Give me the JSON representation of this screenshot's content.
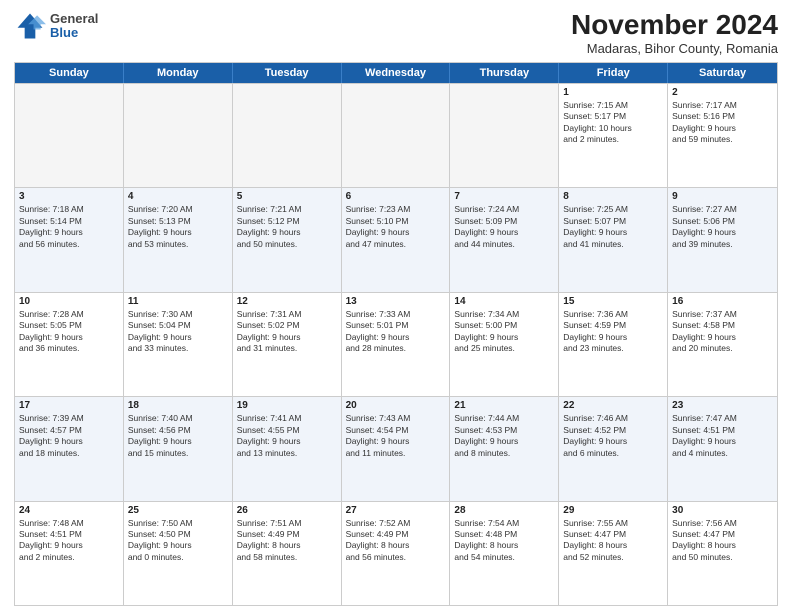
{
  "logo": {
    "general": "General",
    "blue": "Blue"
  },
  "title": "November 2024",
  "location": "Madaras, Bihor County, Romania",
  "days": [
    "Sunday",
    "Monday",
    "Tuesday",
    "Wednesday",
    "Thursday",
    "Friday",
    "Saturday"
  ],
  "rows": [
    [
      {
        "day": "",
        "text": "",
        "empty": true
      },
      {
        "day": "",
        "text": "",
        "empty": true
      },
      {
        "day": "",
        "text": "",
        "empty": true
      },
      {
        "day": "",
        "text": "",
        "empty": true
      },
      {
        "day": "",
        "text": "",
        "empty": true
      },
      {
        "day": "1",
        "text": "Sunrise: 7:15 AM\nSunset: 5:17 PM\nDaylight: 10 hours\nand 2 minutes."
      },
      {
        "day": "2",
        "text": "Sunrise: 7:17 AM\nSunset: 5:16 PM\nDaylight: 9 hours\nand 59 minutes."
      }
    ],
    [
      {
        "day": "3",
        "text": "Sunrise: 7:18 AM\nSunset: 5:14 PM\nDaylight: 9 hours\nand 56 minutes."
      },
      {
        "day": "4",
        "text": "Sunrise: 7:20 AM\nSunset: 5:13 PM\nDaylight: 9 hours\nand 53 minutes."
      },
      {
        "day": "5",
        "text": "Sunrise: 7:21 AM\nSunset: 5:12 PM\nDaylight: 9 hours\nand 50 minutes."
      },
      {
        "day": "6",
        "text": "Sunrise: 7:23 AM\nSunset: 5:10 PM\nDaylight: 9 hours\nand 47 minutes."
      },
      {
        "day": "7",
        "text": "Sunrise: 7:24 AM\nSunset: 5:09 PM\nDaylight: 9 hours\nand 44 minutes."
      },
      {
        "day": "8",
        "text": "Sunrise: 7:25 AM\nSunset: 5:07 PM\nDaylight: 9 hours\nand 41 minutes."
      },
      {
        "day": "9",
        "text": "Sunrise: 7:27 AM\nSunset: 5:06 PM\nDaylight: 9 hours\nand 39 minutes."
      }
    ],
    [
      {
        "day": "10",
        "text": "Sunrise: 7:28 AM\nSunset: 5:05 PM\nDaylight: 9 hours\nand 36 minutes."
      },
      {
        "day": "11",
        "text": "Sunrise: 7:30 AM\nSunset: 5:04 PM\nDaylight: 9 hours\nand 33 minutes."
      },
      {
        "day": "12",
        "text": "Sunrise: 7:31 AM\nSunset: 5:02 PM\nDaylight: 9 hours\nand 31 minutes."
      },
      {
        "day": "13",
        "text": "Sunrise: 7:33 AM\nSunset: 5:01 PM\nDaylight: 9 hours\nand 28 minutes."
      },
      {
        "day": "14",
        "text": "Sunrise: 7:34 AM\nSunset: 5:00 PM\nDaylight: 9 hours\nand 25 minutes."
      },
      {
        "day": "15",
        "text": "Sunrise: 7:36 AM\nSunset: 4:59 PM\nDaylight: 9 hours\nand 23 minutes."
      },
      {
        "day": "16",
        "text": "Sunrise: 7:37 AM\nSunset: 4:58 PM\nDaylight: 9 hours\nand 20 minutes."
      }
    ],
    [
      {
        "day": "17",
        "text": "Sunrise: 7:39 AM\nSunset: 4:57 PM\nDaylight: 9 hours\nand 18 minutes."
      },
      {
        "day": "18",
        "text": "Sunrise: 7:40 AM\nSunset: 4:56 PM\nDaylight: 9 hours\nand 15 minutes."
      },
      {
        "day": "19",
        "text": "Sunrise: 7:41 AM\nSunset: 4:55 PM\nDaylight: 9 hours\nand 13 minutes."
      },
      {
        "day": "20",
        "text": "Sunrise: 7:43 AM\nSunset: 4:54 PM\nDaylight: 9 hours\nand 11 minutes."
      },
      {
        "day": "21",
        "text": "Sunrise: 7:44 AM\nSunset: 4:53 PM\nDaylight: 9 hours\nand 8 minutes."
      },
      {
        "day": "22",
        "text": "Sunrise: 7:46 AM\nSunset: 4:52 PM\nDaylight: 9 hours\nand 6 minutes."
      },
      {
        "day": "23",
        "text": "Sunrise: 7:47 AM\nSunset: 4:51 PM\nDaylight: 9 hours\nand 4 minutes."
      }
    ],
    [
      {
        "day": "24",
        "text": "Sunrise: 7:48 AM\nSunset: 4:51 PM\nDaylight: 9 hours\nand 2 minutes."
      },
      {
        "day": "25",
        "text": "Sunrise: 7:50 AM\nSunset: 4:50 PM\nDaylight: 9 hours\nand 0 minutes."
      },
      {
        "day": "26",
        "text": "Sunrise: 7:51 AM\nSunset: 4:49 PM\nDaylight: 8 hours\nand 58 minutes."
      },
      {
        "day": "27",
        "text": "Sunrise: 7:52 AM\nSunset: 4:49 PM\nDaylight: 8 hours\nand 56 minutes."
      },
      {
        "day": "28",
        "text": "Sunrise: 7:54 AM\nSunset: 4:48 PM\nDaylight: 8 hours\nand 54 minutes."
      },
      {
        "day": "29",
        "text": "Sunrise: 7:55 AM\nSunset: 4:47 PM\nDaylight: 8 hours\nand 52 minutes."
      },
      {
        "day": "30",
        "text": "Sunrise: 7:56 AM\nSunset: 4:47 PM\nDaylight: 8 hours\nand 50 minutes."
      }
    ]
  ]
}
